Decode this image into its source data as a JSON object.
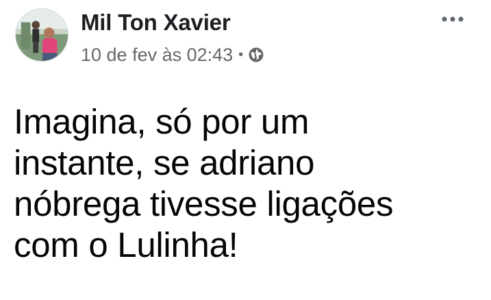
{
  "post": {
    "author_name": "Mil Ton Xavier",
    "timestamp": "10 de fev às 02:43",
    "separator": "•",
    "audience_icon": "globe-icon",
    "more_icon": "more-options-icon",
    "text_lines": [
      "Imagina, só por um",
      "instante, se adriano",
      "nóbrega tivesse ligações",
      "com o Lulinha!"
    ]
  }
}
